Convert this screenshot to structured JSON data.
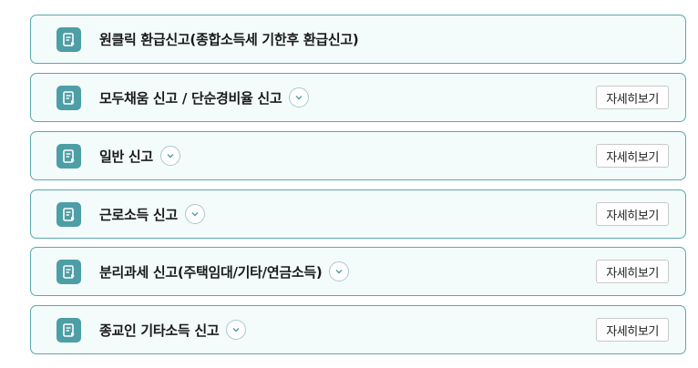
{
  "items": [
    {
      "label": "원클릭 환급신고(종합소득세 기한후 환급신고)",
      "has_toggle": false,
      "detail_label": ""
    },
    {
      "label": "모두채움 신고 / 단순경비율 신고",
      "has_toggle": true,
      "detail_label": "자세히보기"
    },
    {
      "label": "일반 신고",
      "has_toggle": true,
      "detail_label": "자세히보기"
    },
    {
      "label": "근로소득 신고",
      "has_toggle": true,
      "detail_label": "자세히보기"
    },
    {
      "label": "분리과세 신고(주택임대/기타/연금소득)",
      "has_toggle": true,
      "detail_label": "자세히보기"
    },
    {
      "label": "종교인 기타소득 신고",
      "has_toggle": true,
      "detail_label": "자세히보기"
    }
  ],
  "icons": {
    "item_icon": "document-icon",
    "toggle_icon": "chevron-down-icon"
  },
  "colors": {
    "accent": "#4d9ea6",
    "border": "#5aa8ae",
    "card_bg": "#f4fbfb"
  }
}
